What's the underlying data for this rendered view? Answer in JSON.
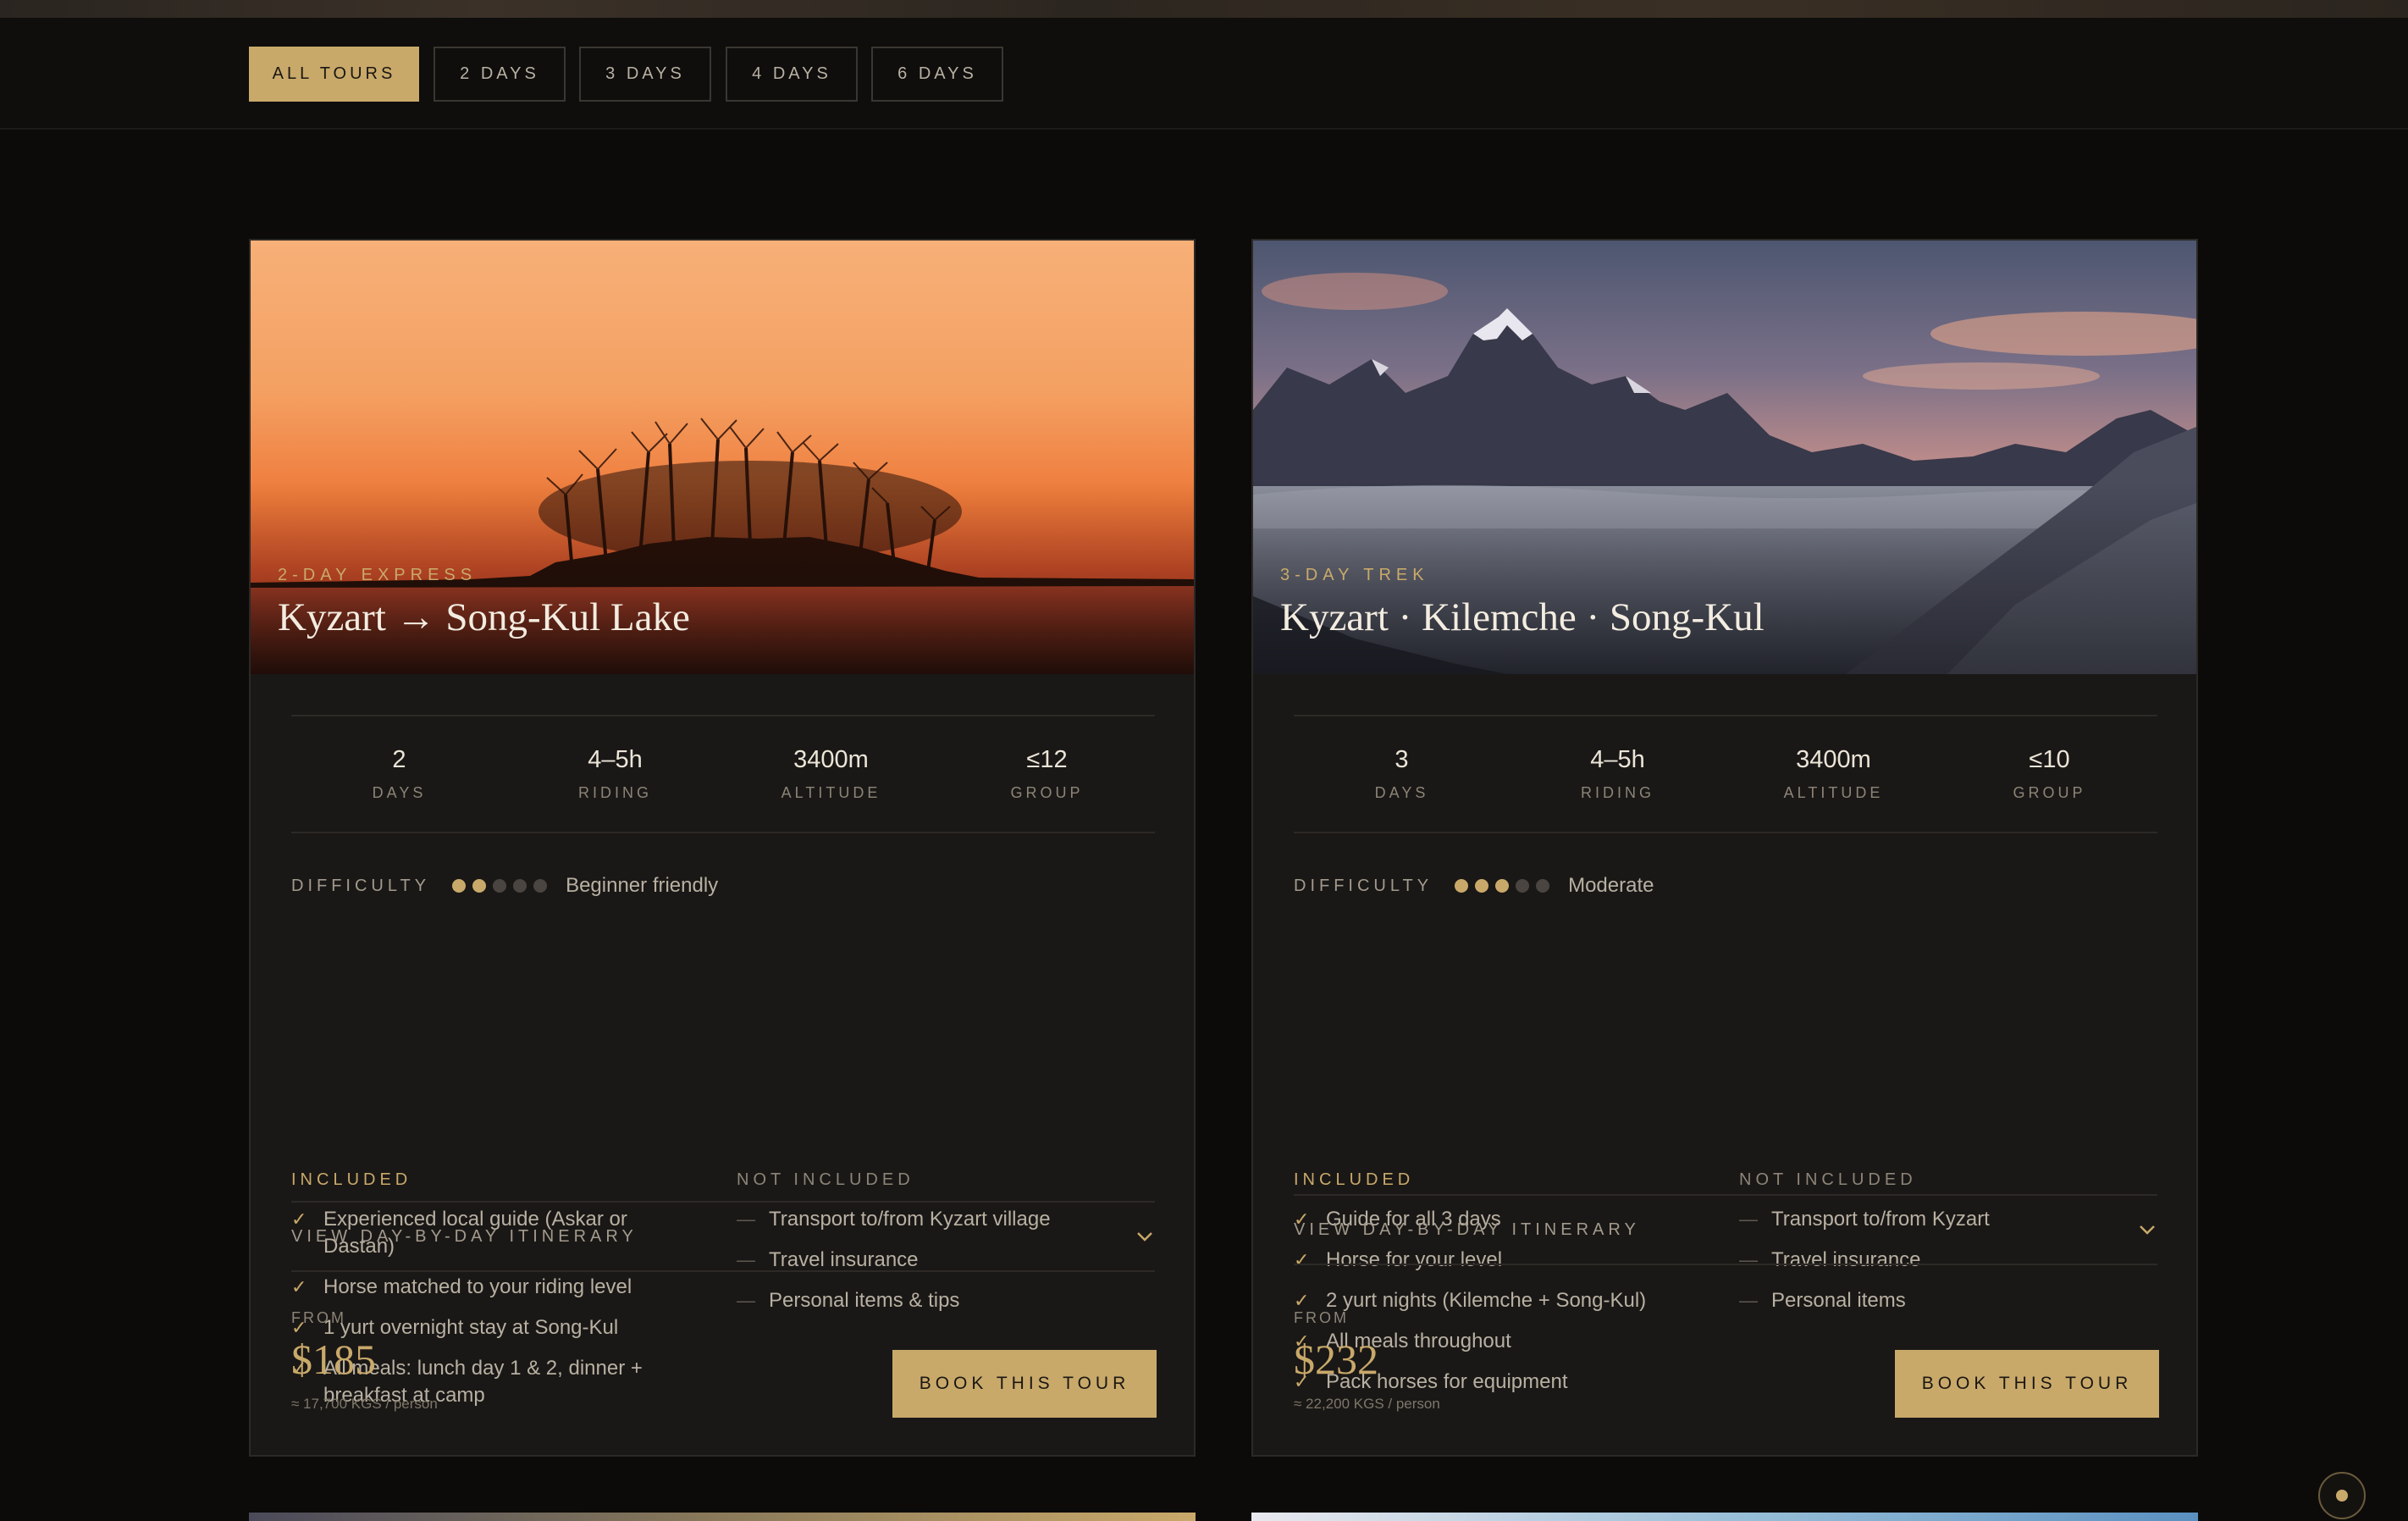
{
  "filters": [
    {
      "label": "ALL TOURS",
      "active": true
    },
    {
      "label": "2 DAYS",
      "active": false
    },
    {
      "label": "3 DAYS",
      "active": false
    },
    {
      "label": "4 DAYS",
      "active": false
    },
    {
      "label": "6 DAYS",
      "active": false
    }
  ],
  "cards": [
    {
      "subtitle": "2-DAY EXPRESS",
      "title": "Kyzart → Song-Kul Lake",
      "stats": [
        {
          "value": "2",
          "label": "DAYS"
        },
        {
          "value": "4–5h",
          "label": "RIDING"
        },
        {
          "value": "3400m",
          "label": "ALTITUDE"
        },
        {
          "value": "≤12",
          "label": "GROUP"
        }
      ],
      "difficulty_label": "DIFFICULTY",
      "difficulty_level": 2,
      "difficulty_max": 5,
      "difficulty_text": "Beginner friendly",
      "included_label": "INCLUDED",
      "included": [
        "Experienced local guide (Askar or Dastan)",
        "Horse matched to your riding level",
        "1 yurt overnight stay at Song-Kul",
        "All meals: lunch day 1 & 2, dinner + breakfast at camp"
      ],
      "not_included_label": "NOT INCLUDED",
      "not_included": [
        "Transport to/from Kyzart village",
        "Travel insurance",
        "Personal items & tips"
      ],
      "itinerary_label": "VIEW DAY-BY-DAY ITINERARY",
      "from_label": "FROM",
      "price": "$185",
      "price_sub": "≈ 17,700 KGS / person",
      "book_label": "BOOK THIS TOUR"
    },
    {
      "subtitle": "3-DAY TREK",
      "title": "Kyzart · Kilemche · Song-Kul",
      "stats": [
        {
          "value": "3",
          "label": "DAYS"
        },
        {
          "value": "4–5h",
          "label": "RIDING"
        },
        {
          "value": "3400m",
          "label": "ALTITUDE"
        },
        {
          "value": "≤10",
          "label": "GROUP"
        }
      ],
      "difficulty_label": "DIFFICULTY",
      "difficulty_level": 3,
      "difficulty_max": 5,
      "difficulty_text": "Moderate",
      "included_label": "INCLUDED",
      "included": [
        "Guide for all 3 days",
        "Horse for your level",
        "2 yurt nights (Kilemche + Song-Kul)",
        "All meals throughout",
        "Pack horses for equipment"
      ],
      "not_included_label": "NOT INCLUDED",
      "not_included": [
        "Transport to/from Kyzart",
        "Travel insurance",
        "Personal items"
      ],
      "itinerary_label": "VIEW DAY-BY-DAY ITINERARY",
      "from_label": "FROM",
      "price": "$232",
      "price_sub": "≈ 22,200 KGS / person",
      "book_label": "BOOK THIS TOUR"
    }
  ],
  "colors": {
    "accent": "#c9a96a",
    "background": "#0c0b0a",
    "card": "#1a1816"
  }
}
